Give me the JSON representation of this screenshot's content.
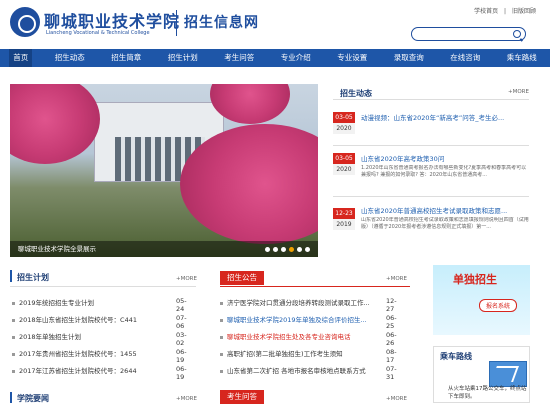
{
  "header": {
    "logo_cn": "聊城职业技术学院",
    "logo_en": "Liancheng Vocational & Technical College",
    "site_title": "招生信息网",
    "top_links": [
      "学校首页",
      "|",
      "旧版回顾"
    ]
  },
  "nav": [
    "首页",
    "招生动态",
    "招生简章",
    "招生计划",
    "考生问答",
    "专业介绍",
    "专业设置",
    "录取查询",
    "在线咨询",
    "乘车路线"
  ],
  "banner": {
    "caption": "聊城职业技术学院全景展示",
    "dot_count": 6
  },
  "news": {
    "title": "招生动态",
    "more": "+MORE",
    "items": [
      {
        "date": "03-05",
        "year": "2020",
        "title": "动漫视频：山东省2020年“新高考”问答_考生必...",
        "summary": ""
      },
      {
        "date": "03-05",
        "year": "2020",
        "title": "山东省2020年高考政策30问",
        "summary": "1.2020年山东省普通高考报名办法有哪些新变化?夏季高考和春季高考可以兼报吗? 兼报的如何录取? 答：2020年山东省普通高考..."
      },
      {
        "date": "12-23",
        "year": "2019",
        "title": "山东省2020年普通高校招生考试录取政策和志愿...",
        "summary": "山东省2020年普通高校招生考试录取政策和志愿填报规则说明且四首（试用版）（遵循于2020年报考者涉遵信息规则正式填报）第一..."
      }
    ]
  },
  "plan": {
    "title": "招生计划",
    "more": "+MORE",
    "rows": [
      {
        "text": "2019年统招招生专业计划",
        "date": "05-24"
      },
      {
        "text": "2018年山东省招生计划院校代号：C441",
        "date": "07-06"
      },
      {
        "text": "2018年单独招生计划",
        "date": "03-02"
      },
      {
        "text": "2017年贵州省招生计划院校代号：1455",
        "date": "06-19"
      },
      {
        "text": "2017年江苏省招生计划院校代号：2644",
        "date": "06-19"
      }
    ]
  },
  "notice": {
    "title": "招生公告",
    "more": "+MORE",
    "rows": [
      {
        "text": "济宁医学院对口贯通分段培养转段测试录取工作...",
        "date": "12-27",
        "style": "normal"
      },
      {
        "text": "聊城职业技术学院2019年单独及综合评价招生...",
        "date": "06-25",
        "style": "link"
      },
      {
        "text": "聊城职业技术学院招生处及各专业咨询电话",
        "date": "06-26",
        "style": "red"
      },
      {
        "text": "高职扩招(第二批单独招生)工作考生须知",
        "date": "08-17",
        "style": "normal"
      },
      {
        "text": "山东省第二次扩招 各地市报名审核地点联系方式",
        "date": "07-31",
        "style": "normal"
      }
    ]
  },
  "school_news": {
    "title": "学院要闻",
    "more": "+MORE"
  },
  "qa": {
    "title": "考生问答",
    "more": "+MORE"
  },
  "side_ad": {
    "title": "单独招生",
    "button": "报名系统"
  },
  "bus": {
    "title": "乘车路线",
    "text": "从火车站乘17路公交车，终点站下车即到。"
  },
  "colors": {
    "nav_blue": "#1e56a8",
    "accent_red": "#d7261e",
    "title_blue": "#1f3f75"
  }
}
